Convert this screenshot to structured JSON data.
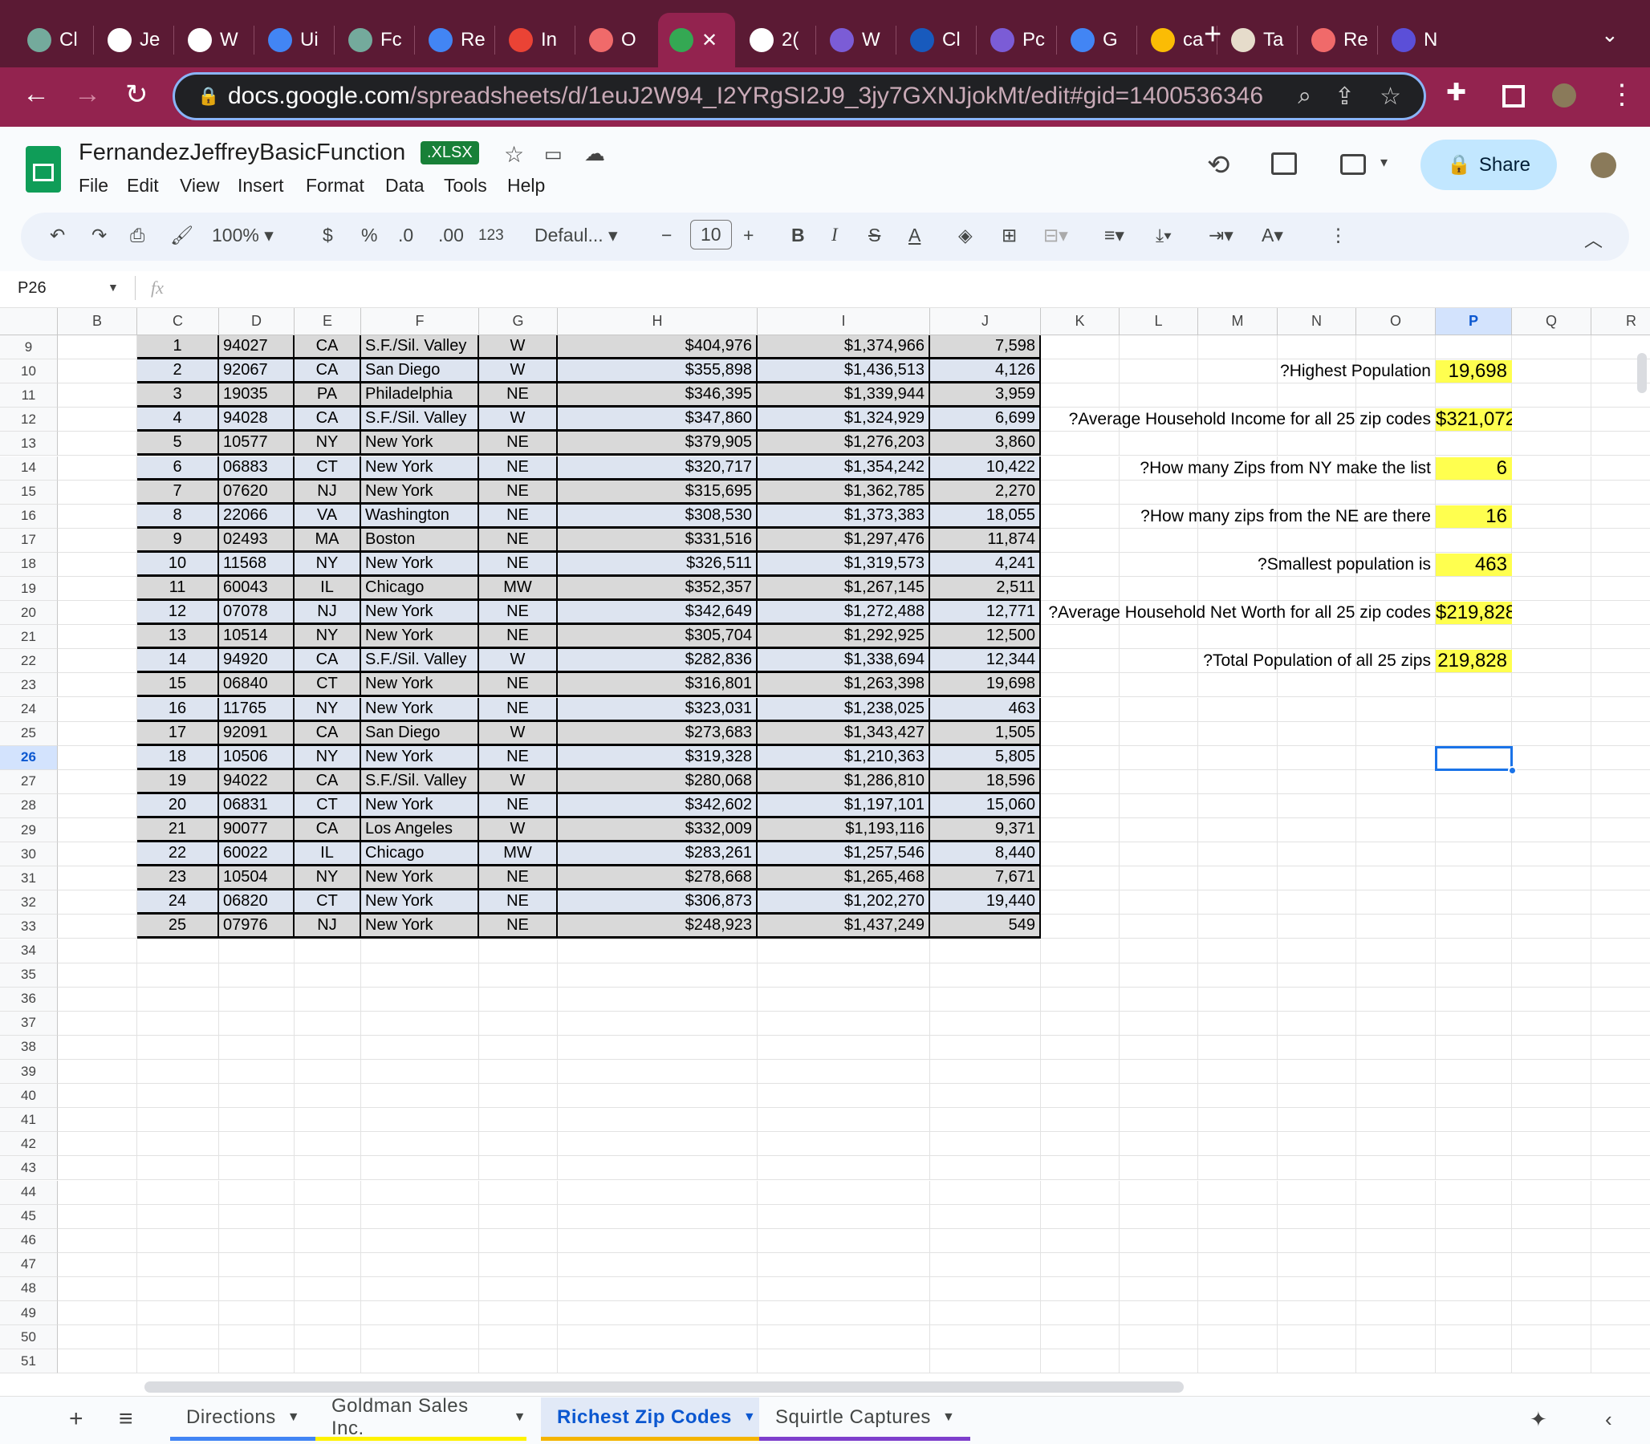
{
  "browser": {
    "tabs": [
      {
        "label": "Cl",
        "color": "#74aa9c"
      },
      {
        "label": "Je",
        "color": "#ffffff"
      },
      {
        "label": "W",
        "color": "#ffffff"
      },
      {
        "label": "Ui",
        "color": "#4285f4"
      },
      {
        "label": "Fc",
        "color": "#74aa9c"
      },
      {
        "label": "Re",
        "color": "#4285f4"
      },
      {
        "label": "In",
        "color": "#ea4335"
      },
      {
        "label": "O",
        "color": "#f06a6a"
      },
      {
        "label": "✕",
        "color": "#34a853"
      },
      {
        "label": "2(",
        "color": "#ffffff"
      },
      {
        "label": "W",
        "color": "#7b5cd6"
      },
      {
        "label": "Cl",
        "color": "#185abd"
      },
      {
        "label": "Pc",
        "color": "#7b5cd6"
      },
      {
        "label": "G",
        "color": "#4285f4"
      },
      {
        "label": "ca",
        "color": "#fbbc05"
      },
      {
        "label": "Ta",
        "color": "#e6dccb"
      },
      {
        "label": "Re",
        "color": "#f06a6a"
      },
      {
        "label": "N",
        "color": "#5b4fd8"
      }
    ],
    "active_tab_index": 8,
    "url_host": "docs.google.com",
    "url_path": "/spreadsheets/d/1euJ2W94_I2YRgSI2J9_3jy7GXNJjokMt/edit#gid=1400536346"
  },
  "doc": {
    "title": "FernandezJeffreyBasicFunction",
    "badge": ".XLSX",
    "share": "Share",
    "menu": [
      "File",
      "Edit",
      "View",
      "Insert",
      "Format",
      "Data",
      "Tools",
      "Help"
    ]
  },
  "toolbar": {
    "zoom": "100%",
    "currency": "$",
    "percent": "%",
    "dec_less": ".0",
    "dec_more": ".00",
    "format_123": "123",
    "font": "Defaul...",
    "font_size": "10"
  },
  "formula_bar": {
    "cell_ref": "P26",
    "fx": "fx",
    "value": ""
  },
  "columns": [
    "B",
    "C",
    "D",
    "E",
    "F",
    "G",
    "H",
    "I",
    "J",
    "K",
    "L",
    "M",
    "N",
    "O",
    "P",
    "Q",
    "R"
  ],
  "selected_column": "P",
  "selected_row": 26,
  "first_row": 9,
  "last_row": 51,
  "table_rows": [
    [
      "1",
      "94027",
      "CA",
      "S.F./Sil. Valley",
      "W",
      "$404,976",
      "$1,374,966",
      "7,598"
    ],
    [
      "2",
      "92067",
      "CA",
      "San Diego",
      "W",
      "$355,898",
      "$1,436,513",
      "4,126"
    ],
    [
      "3",
      "19035",
      "PA",
      "Philadelphia",
      "NE",
      "$346,395",
      "$1,339,944",
      "3,959"
    ],
    [
      "4",
      "94028",
      "CA",
      "S.F./Sil. Valley",
      "W",
      "$347,860",
      "$1,324,929",
      "6,699"
    ],
    [
      "5",
      "10577",
      "NY",
      "New York",
      "NE",
      "$379,905",
      "$1,276,203",
      "3,860"
    ],
    [
      "6",
      "06883",
      "CT",
      "New York",
      "NE",
      "$320,717",
      "$1,354,242",
      "10,422"
    ],
    [
      "7",
      "07620",
      "NJ",
      "New York",
      "NE",
      "$315,695",
      "$1,362,785",
      "2,270"
    ],
    [
      "8",
      "22066",
      "VA",
      "Washington",
      "NE",
      "$308,530",
      "$1,373,383",
      "18,055"
    ],
    [
      "9",
      "02493",
      "MA",
      "Boston",
      "NE",
      "$331,516",
      "$1,297,476",
      "11,874"
    ],
    [
      "10",
      "11568",
      "NY",
      "New York",
      "NE",
      "$326,511",
      "$1,319,573",
      "4,241"
    ],
    [
      "11",
      "60043",
      "IL",
      "Chicago",
      "MW",
      "$352,357",
      "$1,267,145",
      "2,511"
    ],
    [
      "12",
      "07078",
      "NJ",
      "New York",
      "NE",
      "$342,649",
      "$1,272,488",
      "12,771"
    ],
    [
      "13",
      "10514",
      "NY",
      "New York",
      "NE",
      "$305,704",
      "$1,292,925",
      "12,500"
    ],
    [
      "14",
      "94920",
      "CA",
      "S.F./Sil. Valley",
      "W",
      "$282,836",
      "$1,338,694",
      "12,344"
    ],
    [
      "15",
      "06840",
      "CT",
      "New York",
      "NE",
      "$316,801",
      "$1,263,398",
      "19,698"
    ],
    [
      "16",
      "11765",
      "NY",
      "New York",
      "NE",
      "$323,031",
      "$1,238,025",
      "463"
    ],
    [
      "17",
      "92091",
      "CA",
      "San Diego",
      "W",
      "$273,683",
      "$1,343,427",
      "1,505"
    ],
    [
      "18",
      "10506",
      "NY",
      "New York",
      "NE",
      "$319,328",
      "$1,210,363",
      "5,805"
    ],
    [
      "19",
      "94022",
      "CA",
      "S.F./Sil. Valley",
      "W",
      "$280,068",
      "$1,286,810",
      "18,596"
    ],
    [
      "20",
      "06831",
      "CT",
      "New York",
      "NE",
      "$342,602",
      "$1,197,101",
      "15,060"
    ],
    [
      "21",
      "90077",
      "CA",
      "Los Angeles",
      "W",
      "$332,009",
      "$1,193,116",
      "9,371"
    ],
    [
      "22",
      "60022",
      "IL",
      "Chicago",
      "MW",
      "$283,261",
      "$1,257,546",
      "8,440"
    ],
    [
      "23",
      "10504",
      "NY",
      "New York",
      "NE",
      "$278,668",
      "$1,265,468",
      "7,671"
    ],
    [
      "24",
      "06820",
      "CT",
      "New York",
      "NE",
      "$306,873",
      "$1,202,270",
      "19,440"
    ],
    [
      "25",
      "07976",
      "NJ",
      "New York",
      "NE",
      "$248,923",
      "$1,437,249",
      "549"
    ]
  ],
  "questions": [
    {
      "row": 10,
      "label": "Highest Population?",
      "answer": "19,698"
    },
    {
      "row": 12,
      "label": "Average Household Income for all 25 zip codes?",
      "answer": "$321,072"
    },
    {
      "row": 14,
      "label": "How many Zips from NY make the list?",
      "answer": "6"
    },
    {
      "row": 16,
      "label": "How many zips from the NE are there?",
      "answer": "16"
    },
    {
      "row": 18,
      "label": "Smallest population is?",
      "answer": "463"
    },
    {
      "row": 20,
      "label": "Average Household Net Worth for all 25 zip codes?",
      "answer": "$219,828"
    },
    {
      "row": 22,
      "label": "Total Population of all 25 zips?",
      "answer": "219,828"
    }
  ],
  "colors": {
    "highlight": "#ffff4f",
    "row_odd": "#d9d9d9",
    "row_even": "#dde4f0",
    "accent": "#0b57d0"
  },
  "sheets": [
    {
      "label": "Directions",
      "color": "#4285f4"
    },
    {
      "label": "Goldman Sales Inc.",
      "color": "#fff200"
    },
    {
      "label": "Richest Zip Codes",
      "color": "#f4b400",
      "active": true
    },
    {
      "label": "Squirtle Captures",
      "color": "#7e3fcc"
    }
  ]
}
